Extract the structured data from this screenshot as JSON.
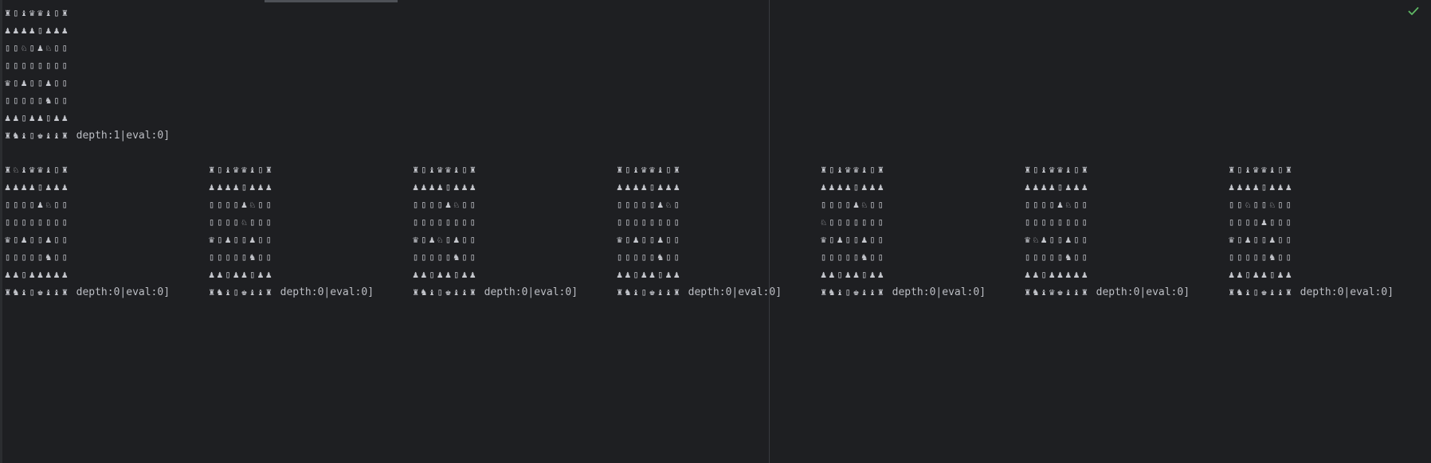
{
  "window": {
    "status_icon": "checkmark-icon",
    "accent": "#5fb865"
  },
  "root_board": {
    "rows": [
      "♜▯♝♛♛♝▯♜",
      "♟♟♟♟▯♟♟♟",
      "▯▯♘▯♟♘▯▯",
      "▯▯▯▯▯▯▯▯",
      "♛▯♟▯▯♟▯▯",
      "▯▯▯▯▯♞▯▯",
      "♟♟▯♟♟▯♟♟",
      "♜♞♝▯♚♝♝♜"
    ],
    "status": " depth:1|eval:0]"
  },
  "child_boards": [
    {
      "rows": [
        "♜♘♝♛♛♝▯♜",
        "♟♟♟♟▯♟♟♟",
        "▯▯▯▯♟♘▯▯",
        "▯▯▯▯▯▯▯▯",
        "♛▯♟▯▯♟▯▯",
        "▯▯▯▯▯♞▯▯",
        "♟♟▯♟♟♟♟♟",
        "♜♞♝▯♚♝♝♜"
      ],
      "status": " depth:0|eval:0]"
    },
    {
      "rows": [
        "♜▯♝♛♛♝▯♜",
        "♟♟♟♟▯♟♟♟",
        "▯▯▯▯♟♘▯▯",
        "▯▯▯▯♘▯▯▯",
        "♛▯♟▯▯♟▯▯",
        "▯▯▯▯▯♞▯▯",
        "♟♟▯♟♟▯♟♟",
        "♜♞♝▯♚♝♝♜"
      ],
      "status": " depth:0|eval:0]"
    },
    {
      "rows": [
        "♜▯♝♛♛♝▯♜",
        "♟♟♟♟▯♟♟♟",
        "▯▯▯▯♟♘▯▯",
        "▯▯▯▯▯▯▯▯",
        "♛▯♟♘▯♟▯▯",
        "▯▯▯▯▯♞▯▯",
        "♟♟▯♟♟▯♟♟",
        "♜♞♝▯♚♝♝♜"
      ],
      "status": " depth:0|eval:0]"
    },
    {
      "rows": [
        "♜▯♝♛♛♝▯♜",
        "♟♟♟♟▯♟♟♟",
        "▯▯▯▯▯♟♘▯",
        "▯▯▯▯▯▯▯▯",
        "♛▯♟▯▯♟▯▯",
        "▯▯▯▯▯♞▯▯",
        "♟♟▯♟♟▯♟♟",
        "♜♞♝▯♚♝♝♜"
      ],
      "status": " depth:0|eval:0]"
    },
    {
      "rows": [
        "♜▯♝♛♛♝▯♜",
        "♟♟♟♟▯♟♟♟",
        "▯▯▯▯♟♘▯▯",
        "♘▯▯▯▯▯▯▯",
        "♛▯♟▯▯♟▯▯",
        "▯▯▯▯▯♞▯▯",
        "♟♟▯♟♟▯♟♟",
        "♜♞♝▯♚♝♝♜"
      ],
      "status": " depth:0|eval:0]"
    },
    {
      "rows": [
        "♜▯♝♛♛♝▯♜",
        "♟♟♟♟▯♟♟♟",
        "▯▯▯▯♟♘▯▯",
        "▯▯▯▯▯▯▯▯",
        "♛♘♟▯▯♟▯▯",
        "▯▯▯▯▯♞▯▯",
        "♟♟▯♟♟♟♟♟",
        "♜♞♝♛♚♝♝♜"
      ],
      "status": " depth:0|eval:0]"
    },
    {
      "rows": [
        "♜▯♝♛♛♝▯♜",
        "♟♟♟♟▯♟♟♟",
        "▯▯♘▯▯♘▯▯",
        "▯▯▯▯♟▯▯▯",
        "♛▯♟▯▯♟▯▯",
        "▯▯▯▯▯♞▯▯",
        "♟♟▯♟♟▯♟♟",
        "♜♞♝▯♚♝♝♜"
      ],
      "status": " depth:0|eval:0]"
    }
  ]
}
